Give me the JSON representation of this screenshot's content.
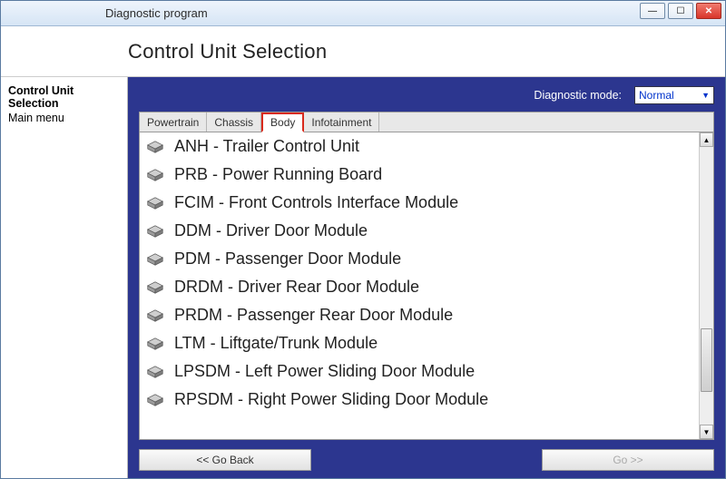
{
  "window": {
    "title": "Diagnostic program"
  },
  "header": {
    "page_title": "Control Unit Selection"
  },
  "sidebar": {
    "items": [
      {
        "label": "Control Unit Selection",
        "bold": true
      },
      {
        "label": "Main menu",
        "bold": false
      }
    ]
  },
  "diag_mode": {
    "label": "Diagnostic mode:",
    "value": "Normal"
  },
  "tabs": [
    {
      "label": "Powertrain",
      "active": false
    },
    {
      "label": "Chassis",
      "active": false
    },
    {
      "label": "Body",
      "active": true
    },
    {
      "label": "Infotainment",
      "active": false
    }
  ],
  "modules": [
    "ANH - Trailer Control Unit",
    "PRB - Power Running Board",
    "FCIM - Front Controls Interface Module",
    "DDM - Driver Door Module",
    "PDM - Passenger Door Module",
    "DRDM - Driver Rear Door Module",
    "PRDM - Passenger Rear Door Module",
    "LTM - Liftgate/Trunk Module",
    "LPSDM - Left Power Sliding Door Module",
    "RPSDM - Right Power Sliding Door Module"
  ],
  "footer": {
    "back": "<< Go Back",
    "go": "Go >>"
  }
}
